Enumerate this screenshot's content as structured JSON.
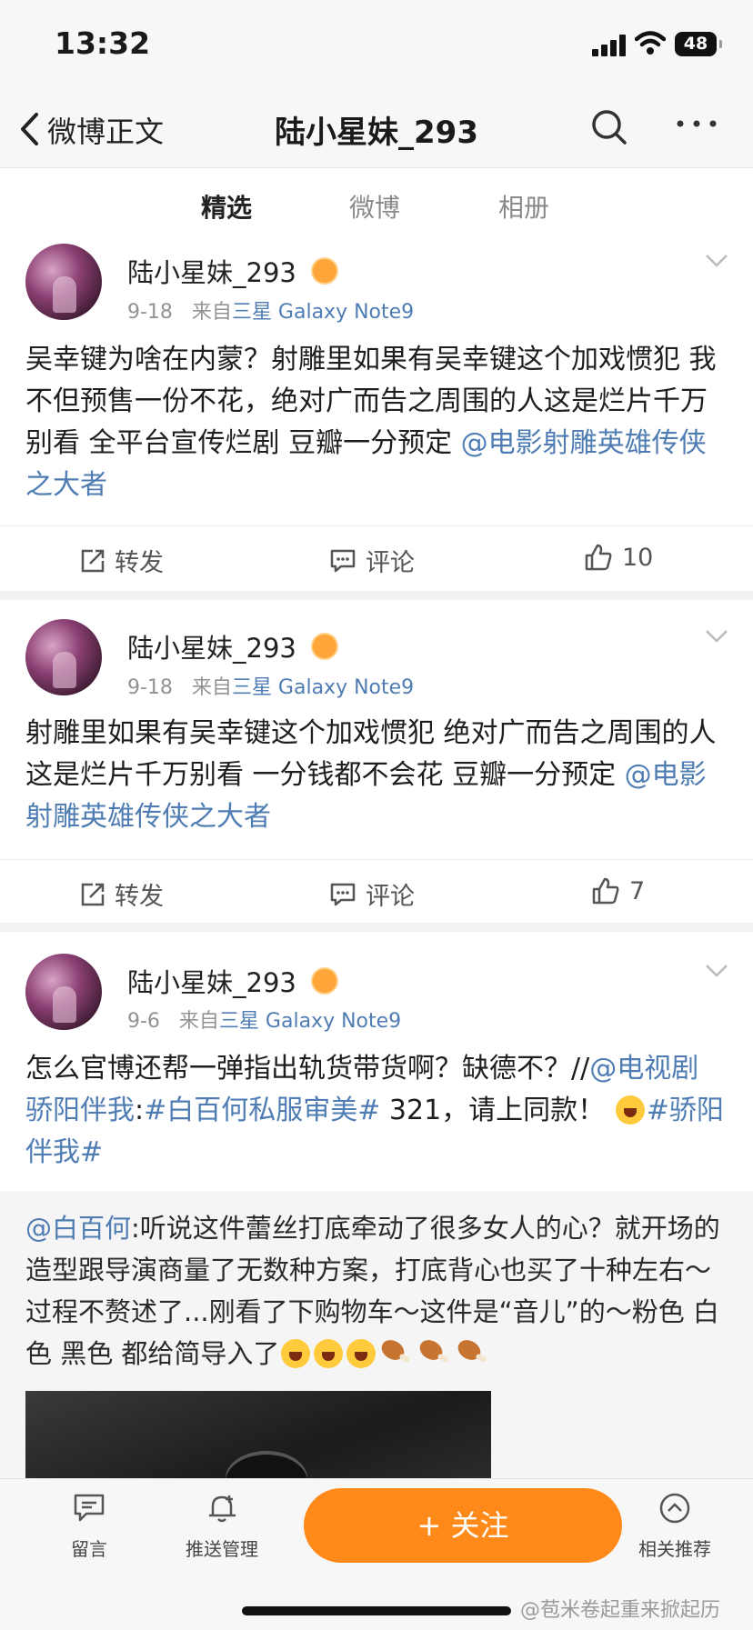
{
  "status_bar": {
    "time": "13:32",
    "battery": "48"
  },
  "nav": {
    "back_label": "微博正文",
    "title": "陆小星妹_293"
  },
  "tabs": [
    {
      "label": "精选",
      "active": true
    },
    {
      "label": "微博",
      "active": false
    },
    {
      "label": "相册",
      "active": false
    }
  ],
  "posts": [
    {
      "username": "陆小星妹_293",
      "date": "9-18",
      "from_label": "来自",
      "source": "三星 Galaxy Note9",
      "text": "吴幸键为啥在内蒙？射雕里如果有吴幸键这个加戏惯犯  我不但预售一份不花，绝对广而告之周围的人这是烂片千万别看   全平台宣传烂剧  豆瓣一分预定 ",
      "mention": "@电影射雕英雄传侠之大者",
      "repost_label": "转发",
      "comment_label": "评论",
      "likes": "10"
    },
    {
      "username": "陆小星妹_293",
      "date": "9-18",
      "from_label": "来自",
      "source": "三星 Galaxy Note9",
      "text": "射雕里如果有吴幸键这个加戏惯犯  绝对广而告之周围的人这是烂片千万别看   一分钱都不会花  豆瓣一分预定 ",
      "mention": "@电影射雕英雄传侠之大者",
      "repost_label": "转发",
      "comment_label": "评论",
      "likes": "7"
    },
    {
      "username": "陆小星妹_293",
      "date": "9-6",
      "from_label": "来自",
      "source": "三星 Galaxy Note9",
      "text": "怎么官博还帮一弹指出轨货带货啊？缺德不？//",
      "mention": "@电视剧骄阳伴我",
      "text2": ":",
      "hashtag1": "#白百何私服审美#",
      "text3": " 321，请上同款！",
      "hashtag2": "#骄阳伴我#"
    }
  ],
  "retweet": {
    "mention": "@白百何",
    "text": ":听说这件蕾丝打底牵动了很多女人的心？就开场的造型跟导演商量了无数种方案，打底背心也买了十种左右～过程不赘述了...刚看了下购物车～这件是“音儿”的～粉色 白色 黑色 都给简导入了"
  },
  "bottom_bar": {
    "message": "留言",
    "push": "推送管理",
    "follow": "+ 关注",
    "related": "相关推荐",
    "watermark": "@苞米卷起重来掀起历"
  },
  "colors": {
    "accent": "#ff8200",
    "link": "#4f7db3"
  }
}
